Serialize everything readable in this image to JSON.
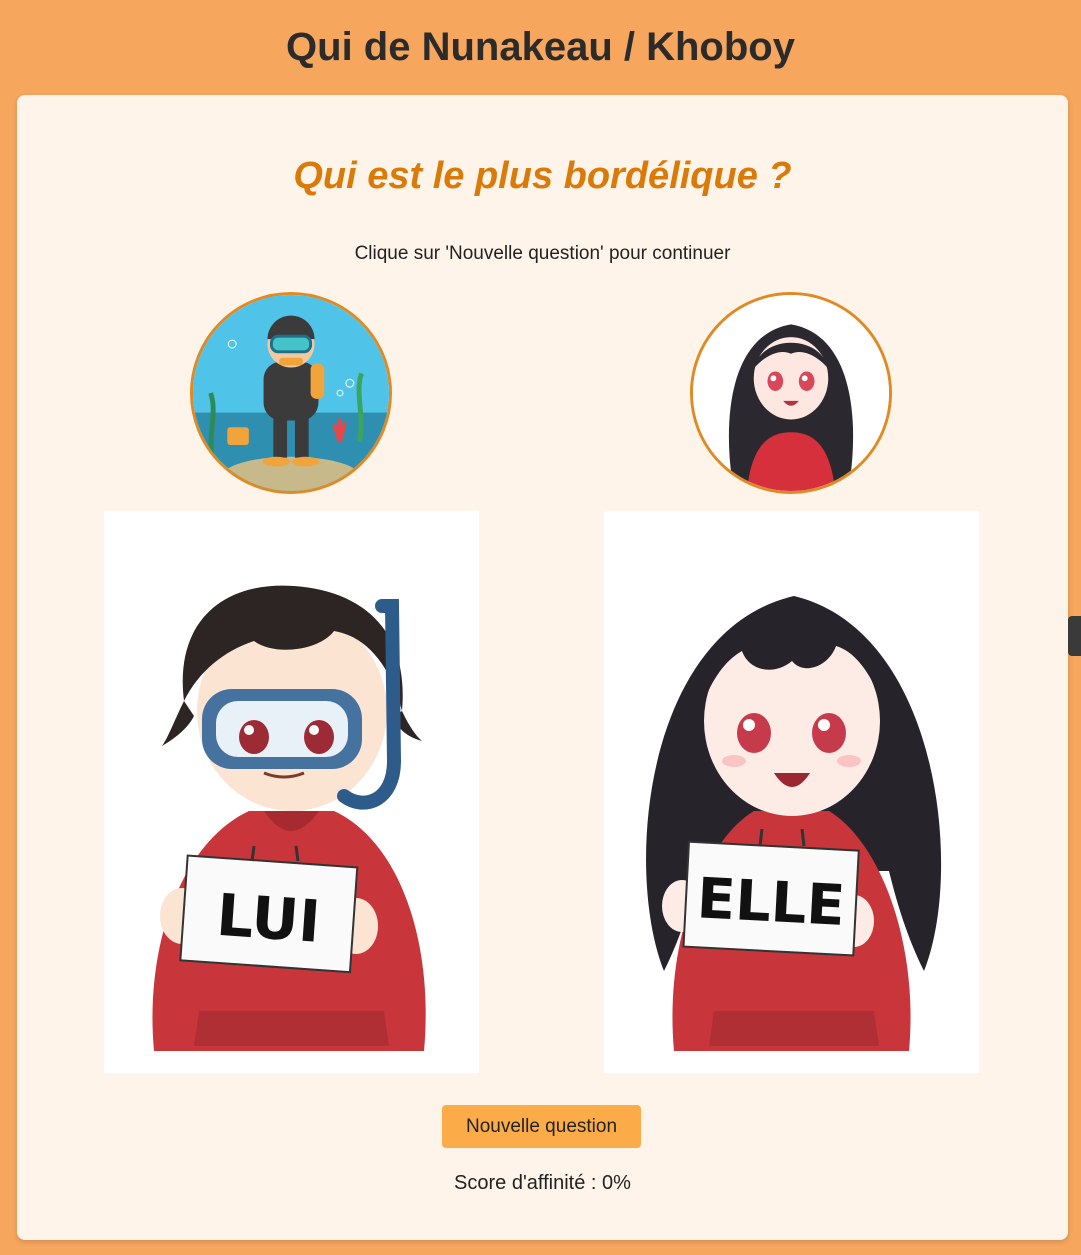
{
  "header": {
    "title": "Qui de Nunakeau / Khoboy"
  },
  "quiz": {
    "question": "Qui est le plus bordélique ?",
    "hint": "Clique sur 'Nouvelle question' pour continuer",
    "choices": [
      {
        "id": "lui",
        "sign": "LUI",
        "avatar_icon": "diver-avatar-icon"
      },
      {
        "id": "elle",
        "sign": "ELLE",
        "avatar_icon": "anime-girl-avatar-icon"
      }
    ],
    "new_question_label": "Nouvelle question",
    "score_text": "Score d'affinité : 0%"
  },
  "colors": {
    "background": "#f7a65e",
    "card": "#fff4ea",
    "accent": "#d97a09",
    "button": "#fbac48"
  }
}
